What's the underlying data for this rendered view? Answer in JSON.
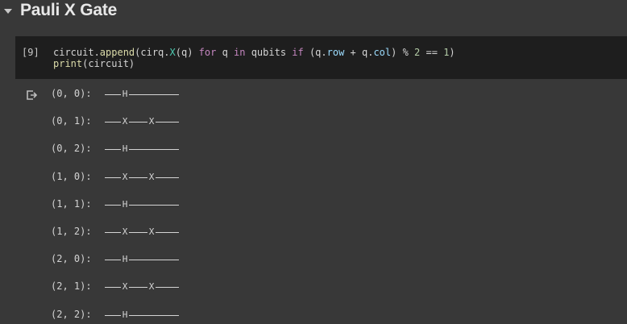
{
  "section": {
    "title": "Pauli X Gate",
    "caret_icon": "caret-down-icon"
  },
  "cell": {
    "execution_count": "[9]",
    "code": {
      "line1": {
        "p1": "circuit.",
        "p2": "append",
        "p3": "(cirq.",
        "p4": "X",
        "p5": "(q) ",
        "p6": "for",
        "p7": " q ",
        "p8": "in",
        "p9": " qubits ",
        "p10": "if",
        "p11": " (q.",
        "p12": "row",
        "p13": " + q.",
        "p14": "col",
        "p15": ") % ",
        "p16": "2",
        "p17": " == ",
        "p18": "1",
        "p19": ")"
      },
      "line2": {
        "p1": "print",
        "p2": "(circuit)"
      }
    }
  },
  "output": {
    "icon": "output-redirect-icon",
    "rows": [
      {
        "label": "(0, 0): ",
        "gates": [
          "H"
        ]
      },
      {
        "label": "(0, 1): ",
        "gates": [
          "X",
          "X"
        ]
      },
      {
        "label": "(0, 2): ",
        "gates": [
          "H"
        ]
      },
      {
        "label": "(1, 0): ",
        "gates": [
          "X",
          "X"
        ]
      },
      {
        "label": "(1, 1): ",
        "gates": [
          "H"
        ]
      },
      {
        "label": "(1, 2): ",
        "gates": [
          "X",
          "X"
        ]
      },
      {
        "label": "(2, 0): ",
        "gates": [
          "H"
        ]
      },
      {
        "label": "(2, 1): ",
        "gates": [
          "X",
          "X"
        ]
      },
      {
        "label": "(2, 2): ",
        "gates": [
          "H"
        ]
      }
    ]
  }
}
